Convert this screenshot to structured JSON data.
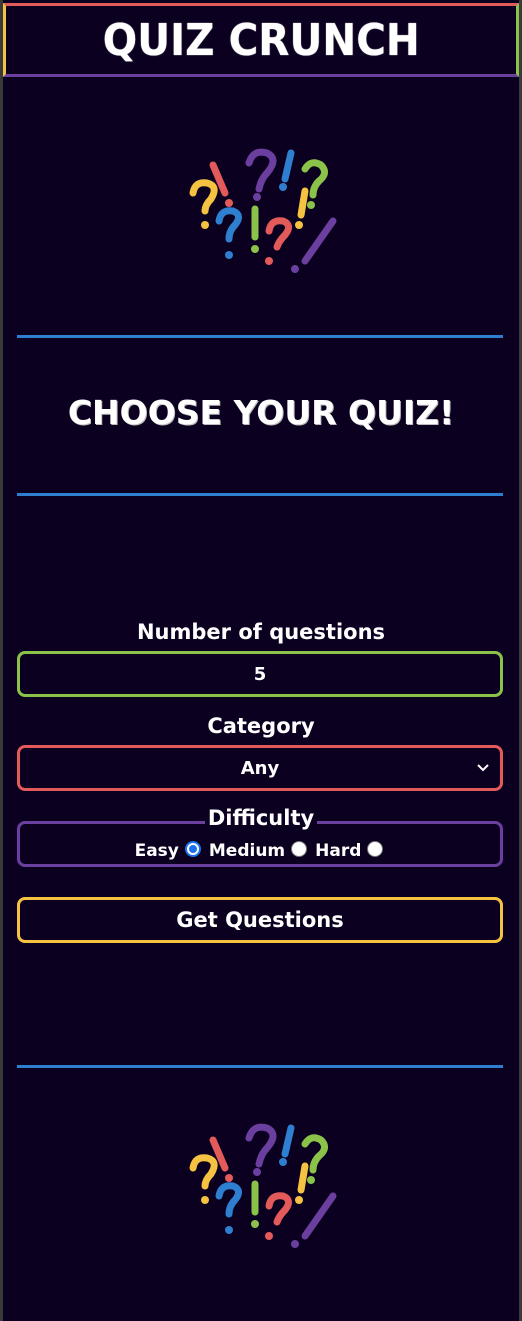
{
  "header": {
    "title": "QUIZ CRUNCH"
  },
  "logo": {
    "icon": "question-exclamation-marks-logo"
  },
  "main": {
    "subtitle": "CHOOSE YOUR QUIZ!",
    "number_label": "Number of questions",
    "number_value": "5",
    "category_label": "Category",
    "category_value": "Any",
    "difficulty_label": "Difficulty",
    "difficulty_options": [
      {
        "label": "Easy",
        "checked": true
      },
      {
        "label": "Medium",
        "checked": false
      },
      {
        "label": "Hard",
        "checked": false
      }
    ],
    "submit_label": "Get Questions"
  },
  "colors": {
    "background": "#0c0020",
    "red": "#e35a5a",
    "green": "#8bc34a",
    "purple": "#6b3fa0",
    "yellow": "#f5c242",
    "blue": "#2f7fd0",
    "radio": "#1a73e8"
  }
}
